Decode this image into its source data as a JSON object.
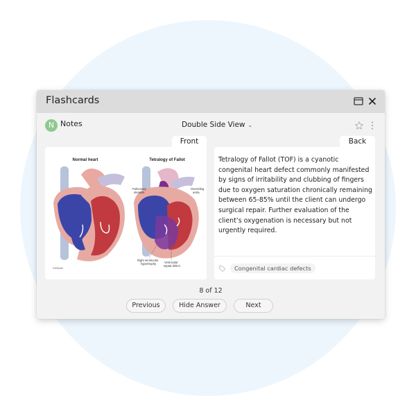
{
  "window": {
    "title": "Flashcards",
    "controls": {
      "maximize_icon": "window-maximize-icon",
      "close_icon": "close-icon"
    }
  },
  "toolbar": {
    "avatar_initial": "N",
    "notes_label": "Notes",
    "view_mode": "Double Side View",
    "view_mode_chevron": "⌄",
    "star_icon": "star-outline-icon",
    "more_icon": "vertical-ellipsis-icon"
  },
  "card": {
    "front_tab": "Front",
    "back_tab": "Back",
    "front_image": {
      "left_title": "Normal heart",
      "right_title": "Tetralogy of Fallot",
      "labels": {
        "pulmonary_stenosis": [
          "Pulmonary",
          "stenosis"
        ],
        "overriding_aorta": [
          "Overriding",
          "aorta"
        ],
        "rv_hypertrophy": [
          "Right ventricular",
          "hypertrophy"
        ],
        "vsd": [
          "Ventricular",
          "septal defect"
        ]
      },
      "copyright": "©UWorld"
    },
    "back_text": "Tetralogy of Fallot (TOF) is a cyanotic congenital heart defect commonly manifested by signs of irritability and clubbing of fingers due to oxygen saturation chronically remaining between 65-85% until the client can undergo surgical repair.  Further evaluation of the client’s oxygenation is necessary but not urgently required.",
    "tag_icon": "tag-icon",
    "tags": [
      "Congenital cardiac defects"
    ]
  },
  "navigation": {
    "counter": "8 of 12",
    "current": 8,
    "total": 12,
    "previous_label": "Previous",
    "hide_answer_label": "Hide Answer",
    "next_label": "Next"
  },
  "colors": {
    "background_circle": "#eef6fd",
    "titlebar": "#dcdcdc",
    "window_body": "#f2f2f2",
    "avatar": "#8fc98f"
  }
}
